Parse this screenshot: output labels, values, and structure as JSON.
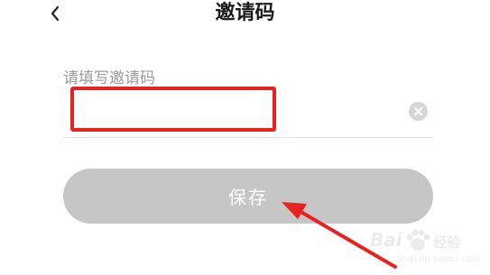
{
  "header": {
    "title": "邀请码",
    "back_icon": "chevron-left-icon"
  },
  "form": {
    "label": "请填写邀请码",
    "input_value": "",
    "clear_icon": "clear-circle-icon"
  },
  "actions": {
    "save_label": "保存"
  },
  "annotation": {
    "highlight_color": "#e8231f",
    "arrow_color": "#e8231f"
  },
  "watermark": {
    "brand": "Bai",
    "brand_suffix": "经验",
    "url": "jingyan.baidu.com"
  }
}
